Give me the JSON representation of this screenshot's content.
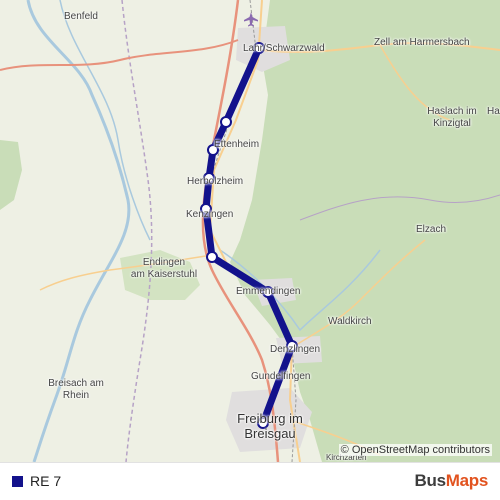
{
  "map": {
    "attribution": "© OpenStreetMap contributors",
    "airport_icon": "airplane-icon",
    "places": {
      "benfeld": "Benfeld",
      "lahr": "Lahr/Schwarzwald",
      "zell": "Zell am Harmersbach",
      "ha": "Ha",
      "haslach_line1": "Haslach im",
      "haslach_line2": "Kinzigtal",
      "ettenheim": "Ettenheim",
      "herbolzheim": "Herbolzheim",
      "kenzingen": "Kenzingen",
      "elzach": "Elzach",
      "endingen_line1": "Endingen",
      "endingen_line2": "am Kaiserstuhl",
      "emmendingen": "Emmendingen",
      "waldkirch": "Waldkirch",
      "denzlingen": "Denzlingen",
      "gundelfingen": "Gundelfingen",
      "breisach_line1": "Breisach am",
      "breisach_line2": "Rhein",
      "freiburg_line1": "Freiburg im",
      "freiburg_line2": "Breisgau",
      "kirchzarten": "Kirchzarten"
    }
  },
  "route": {
    "name": "RE 7",
    "color": "#13128c",
    "stop_count": 9
  },
  "brand": {
    "part1": "Bus",
    "part2": "Maps",
    "color1": "#3d3d3d",
    "color2": "#e2531f"
  },
  "colors": {
    "forest": "#c9ddb8",
    "farmland": "#f1f2e4",
    "urban": "#e0dede",
    "river": "#a9c9de",
    "motorway": "#e8927c",
    "primary_road": "#f8cf8f",
    "railway": "#9a9a9a",
    "border": "#b6a2c6"
  }
}
